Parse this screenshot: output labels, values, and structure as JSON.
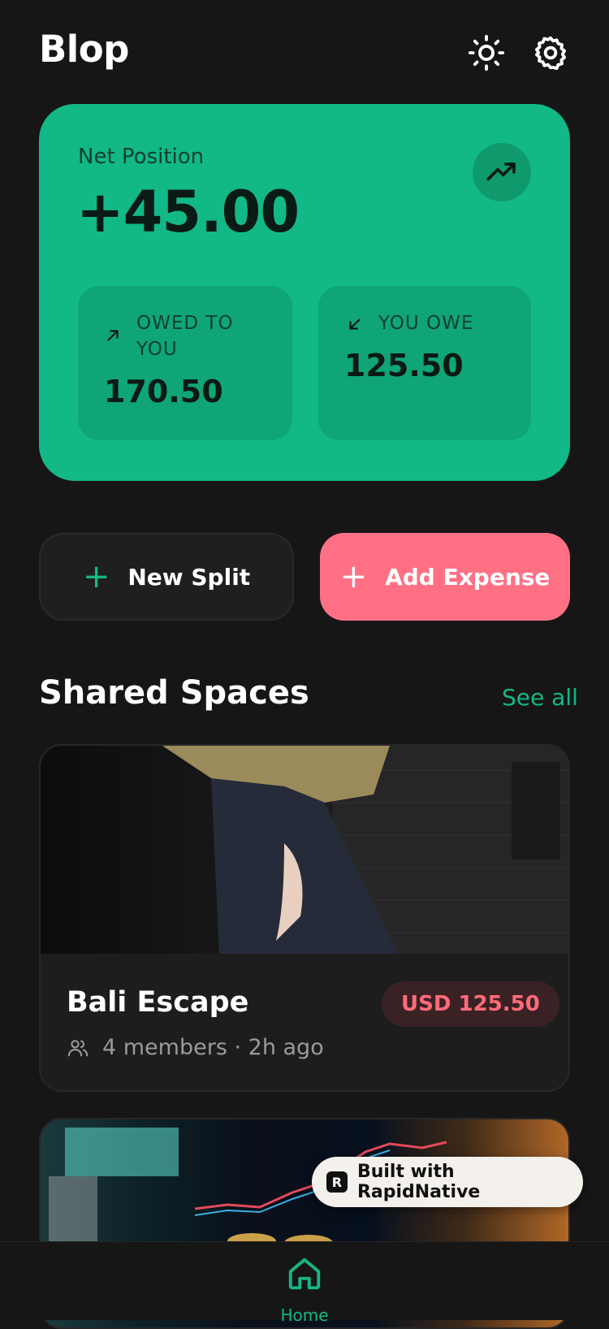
{
  "header": {
    "title": "Blop",
    "theme_icon": "sun-icon",
    "settings_icon": "gear-icon"
  },
  "net_position": {
    "label": "Net Position",
    "value": "+45.00",
    "trend_icon": "trending-up-icon",
    "owed_to_you": {
      "label": "OWED TO YOU",
      "value": "170.50",
      "icon": "arrow-up-right-icon"
    },
    "you_owe": {
      "label": "YOU OWE",
      "value": "125.50",
      "icon": "arrow-down-left-icon"
    }
  },
  "actions": {
    "new_split": "New Split",
    "add_expense": "Add Expense"
  },
  "shared_spaces": {
    "title": "Shared Spaces",
    "see_all": "See all",
    "items": [
      {
        "name": "Bali Escape",
        "meta": "4 members · 2h ago",
        "amount": "USD 125.50"
      }
    ]
  },
  "badge": {
    "text": "Built with RapidNative"
  },
  "tabbar": {
    "home_label": "Home"
  },
  "colors": {
    "background": "#161616",
    "accent_green": "#12b886",
    "accent_pink": "#ff7085",
    "debt_red": "#ff6b7a"
  }
}
